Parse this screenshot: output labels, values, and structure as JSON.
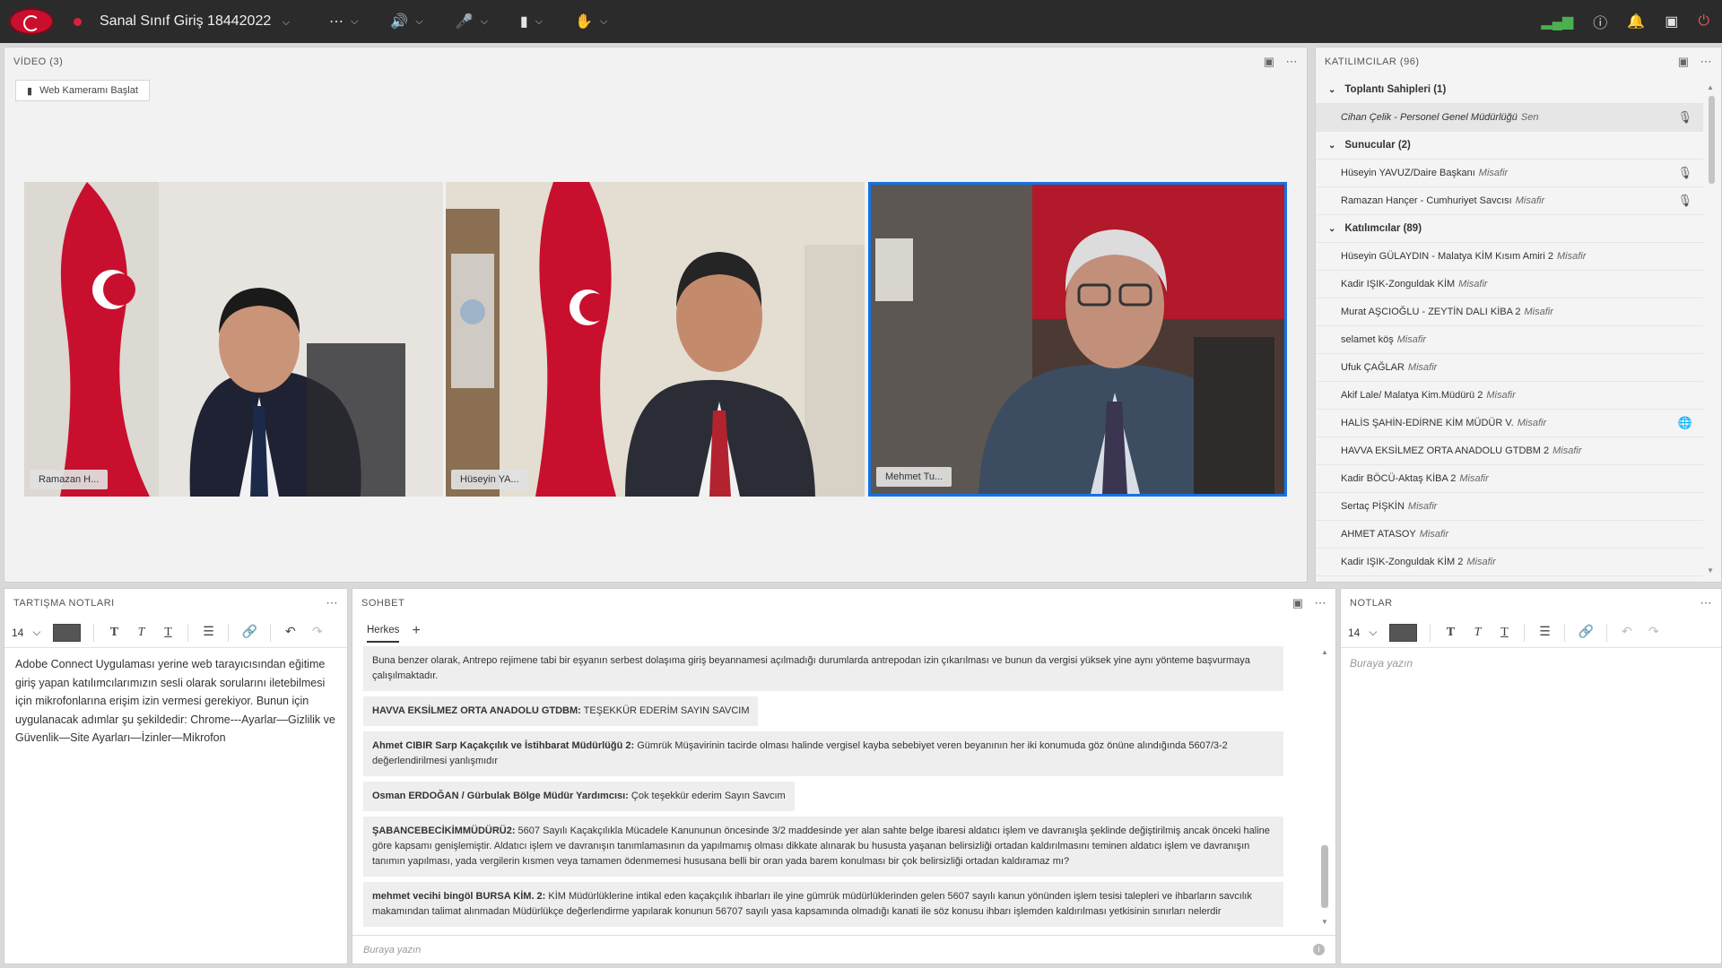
{
  "topbar": {
    "title": "Sanal Sınıf Giriş 18442022",
    "icons": [
      "layout-grid-icon",
      "speaker-icon",
      "mic-muted-icon",
      "camera-icon",
      "raise-hand-icon",
      "signal-icon",
      "help-icon",
      "bell-icon",
      "fullscreen-icon",
      "power-icon"
    ],
    "accent": "#1473e6"
  },
  "video": {
    "title": "VİDEO (3)",
    "start_cam_label": "Web Kameramı Başlat",
    "tiles": [
      {
        "name": "Ramazan H...",
        "active": false
      },
      {
        "name": "Hüseyin YA...",
        "active": false
      },
      {
        "name": "Mehmet Tu...",
        "active": true
      }
    ]
  },
  "participants": {
    "title": "KATILIMCILAR  (96)",
    "groups": [
      {
        "label": "Toplantı Sahipleri (1)",
        "members": [
          {
            "name": "Cihan Çelik - Personel Genel Müdürlüğü",
            "role": "Sen",
            "icon": "mic"
          }
        ]
      },
      {
        "label": "Sunucular (2)",
        "members": [
          {
            "name": "Hüseyin YAVUZ/Daire Başkanı",
            "role": "Misafir",
            "icon": "mic"
          },
          {
            "name": "Ramazan Hançer - Cumhuriyet Savcısı",
            "role": "Misafir",
            "icon": "mic"
          }
        ]
      },
      {
        "label": "Katılımcılar (89)",
        "members": [
          {
            "name": "Hüseyin GÜLAYDIN - Malatya KİM Kısım Amiri 2",
            "role": "Misafir",
            "icon": ""
          },
          {
            "name": "Kadir IŞIK-Zonguldak KİM",
            "role": "Misafir",
            "icon": ""
          },
          {
            "name": "Murat AŞCIOĞLU - ZEYTİN DALI KİBA 2",
            "role": "Misafir",
            "icon": ""
          },
          {
            "name": "selamet köş",
            "role": "Misafir",
            "icon": ""
          },
          {
            "name": "Ufuk ÇAĞLAR",
            "role": "Misafir",
            "icon": ""
          },
          {
            "name": "Akif Lale/ Malatya Kim.Müdürü 2",
            "role": "Misafir",
            "icon": ""
          },
          {
            "name": "HALİS ŞAHİN-EDİRNE KİM MÜDÜR V.",
            "role": "Misafir",
            "icon": "globe"
          },
          {
            "name": "HAVVA EKSİLMEZ ORTA ANADOLU GTDBM 2",
            "role": "Misafir",
            "icon": ""
          },
          {
            "name": "Kadir BÖCÜ-Aktaş KİBA 2",
            "role": "Misafir",
            "icon": ""
          },
          {
            "name": "Sertaç PİŞKİN",
            "role": "Misafir",
            "icon": ""
          },
          {
            "name": "AHMET ATASOY",
            "role": "Misafir",
            "icon": ""
          },
          {
            "name": "Kadir IŞIK-Zonguldak KİM 2",
            "role": "Misafir",
            "icon": ""
          }
        ]
      }
    ]
  },
  "discussion_notes": {
    "title": "TARTIŞMA NOTLARI",
    "font_size": "14",
    "text": "Adobe Connect Uygulaması yerine web tarayıcısından eğitime giriş yapan katılımcılarımızın sesli olarak sorularını iletebilmesi için mikrofonlarına erişim izin vermesi gerekiyor. Bunun için uygulanacak adımlar şu şekildedir: Chrome---Ayarlar—Gizlilik ve Güvenlik—Site Ayarları—İzinler—Mikrofon"
  },
  "chat": {
    "title": "SOHBET",
    "tab": "Herkes",
    "input_placeholder": "Buraya yazın",
    "messages": [
      {
        "sender": "",
        "text": "Buna benzer olarak, Antrepo rejimene tabi bir eşyanın serbest dolaşıma giriş beyannamesi açılmadığı durumlarda antrepodan izin çıkarılması ve bunun da vergisi yüksek yine aynı yönteme başvurmaya çalışılmaktadır."
      },
      {
        "sender": "HAVVA EKSİLMEZ ORTA ANADOLU GTDBM:",
        "text": " TEŞEKKÜR EDERİM SAYIN SAVCIM"
      },
      {
        "sender": "Ahmet CIBIR Sarp Kaçakçılık ve İstihbarat Müdürlüğü 2:",
        "text": "  Gümrük Müşavirinin tacirde olması halinde vergisel kayba sebebiyet veren beyanının her iki konumuda göz önüne alındığında 5607/3-2 değerlendirilmesi yanlışmıdır"
      },
      {
        "sender": "Osman ERDOĞAN / Gürbulak Bölge Müdür Yardımcısı:",
        "text": " Çok teşekkür ederim Sayın Savcım"
      },
      {
        "sender": "ŞABANCEBECİKİMMÜDÜRÜ2:",
        "text": " 5607 Sayılı Kaçakçılıkla Mücadele Kanununun öncesinde 3/2 maddesinde yer alan sahte belge ibaresi aldatıcı işlem ve davranışla şeklinde değiştirilmiş ancak önceki haline göre kapsamı genişlemiştir. Aldatıcı işlem ve davranışın tanımlamasının da yapılmamış olması dikkate alınarak bu hususta yaşanan belirsizliği ortadan kaldırılmasını teminen  aldatıcı işlem ve davranışın  tanımın yapılması, yada vergilerin kısmen veya tamamen ödenmemesi hususana  belli bir oran yada barem konulması  bir çok belirsizliği ortadan kaldıramaz mı?"
      },
      {
        "sender": "mehmet vecihi bingöl BURSA KİM. 2:",
        "text": " KİM Müdürlüklerine intikal eden kaçakçılık ihbarları ile yine gümrük müdürlüklerinden gelen 5607 sayılı kanun yönünden işlem tesisi talepleri ve  ihbarların savcılık makamından talimat alınmadan Müdürlükçe değerlendirme yapılarak konunun 56707 sayılı yasa kapsamında olmadığı kanati ile söz konusu ihbarı işlemden kaldırılması yetkisinin sınırları nelerdir"
      }
    ]
  },
  "notes": {
    "title": "NOTLAR",
    "font_size": "14",
    "placeholder": "Buraya yazın"
  }
}
